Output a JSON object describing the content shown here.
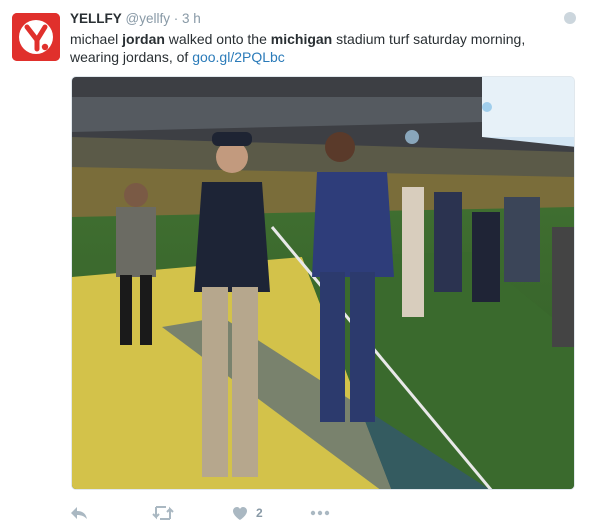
{
  "author": {
    "name": "YELLFY",
    "handle": "@yellfy",
    "separator": "·",
    "time": "3 h",
    "avatar_color": "#e0302c"
  },
  "tweet": {
    "text_parts": [
      "michael ",
      "jordan",
      " walked onto the ",
      "michigan",
      " stadium turf saturday morning,",
      "wearing jordans, of ",
      "goo.gl/2PQLbc"
    ]
  },
  "media": {
    "icon": "photo",
    "description_icon": "stadium-photo"
  },
  "actions": {
    "reply_icon": "reply-icon",
    "retweet_icon": "retweet-icon",
    "like_icon": "heart-icon",
    "like_count": "2",
    "more_icon": "more-icon"
  },
  "colors": {
    "link": "#2b7bb9",
    "muted": "#8899a6"
  }
}
